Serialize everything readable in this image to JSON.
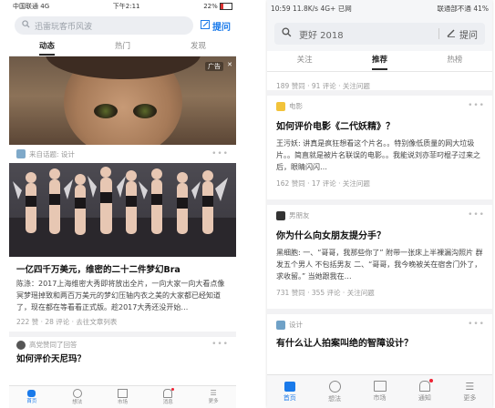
{
  "phone1": {
    "status": {
      "carrier": "中国联通",
      "network": "4G",
      "time": "下午2:11",
      "battery": "22%"
    },
    "search_placeholder": "迅雷玩客币风波",
    "ask_label": "提问",
    "tabs": [
      "动态",
      "热门",
      "发现"
    ],
    "ad_label": "广告",
    "topic_label": "来自话题: 设计",
    "article": {
      "title": "一亿四千万美元，维密的二十二件梦幻Bra",
      "excerpt": "陈涤：2017上海维密大秀即将放出全片，一向大家一向大看点像冥梦瑶掉致和两百万美元的梦幻压轴内衣之美的大家都已经知道了，现在都在等看看正式版。趁2017大秀还没开始…",
      "meta": "222 赞 · 28 评论 · 去往文章列表"
    },
    "next_by": "高党赞同了回答",
    "next_title": "如何评价天尼玛？",
    "bottom_nav": [
      "首页",
      "想法",
      "市场",
      "消息",
      "更多"
    ]
  },
  "phone2": {
    "status": {
      "time": "10:59",
      "speed": "11.8K/s",
      "network": "4G+",
      "state": "已网",
      "carrier": "联通部不通",
      "battery": "41%"
    },
    "search_placeholder": "更好 2018",
    "ask_label": "提问",
    "tabs": [
      "关注",
      "推荐",
      "热榜"
    ],
    "top_meta": "189 赞同 · 91 评论 · 关注问题",
    "cards": [
      {
        "topic": "电影",
        "title": "如何评价电影《二代妖精》？",
        "excerpt": "王污妖: 讲真是疯狂想看这个片名。。特别像低质量的网大垃圾片。。简直就是被片名联误的电影。。我能说刘亦菲叼棍子过来之后，眼睛闪闪…",
        "meta": "162 赞同 · 17 评论 · 关注问题"
      },
      {
        "topic": "男朋友",
        "title": "你为什么向女朋友提分手？",
        "excerpt": "黑细胞: 一、“哥哥，我那些你了” 附带一张床上半裸漏沟照片 群发五个男人 不包括男友 二、“哥哥，我今晚被关在宿舍门外了，求收留。” 当她跟我在…",
        "meta": "731 赞同 · 355 评论 · 关注问题"
      },
      {
        "topic": "设计",
        "title": "有什么让人拍案叫绝的智障设计？"
      }
    ],
    "bottom_nav": [
      "首页",
      "想法",
      "市场",
      "通知",
      "更多"
    ]
  }
}
